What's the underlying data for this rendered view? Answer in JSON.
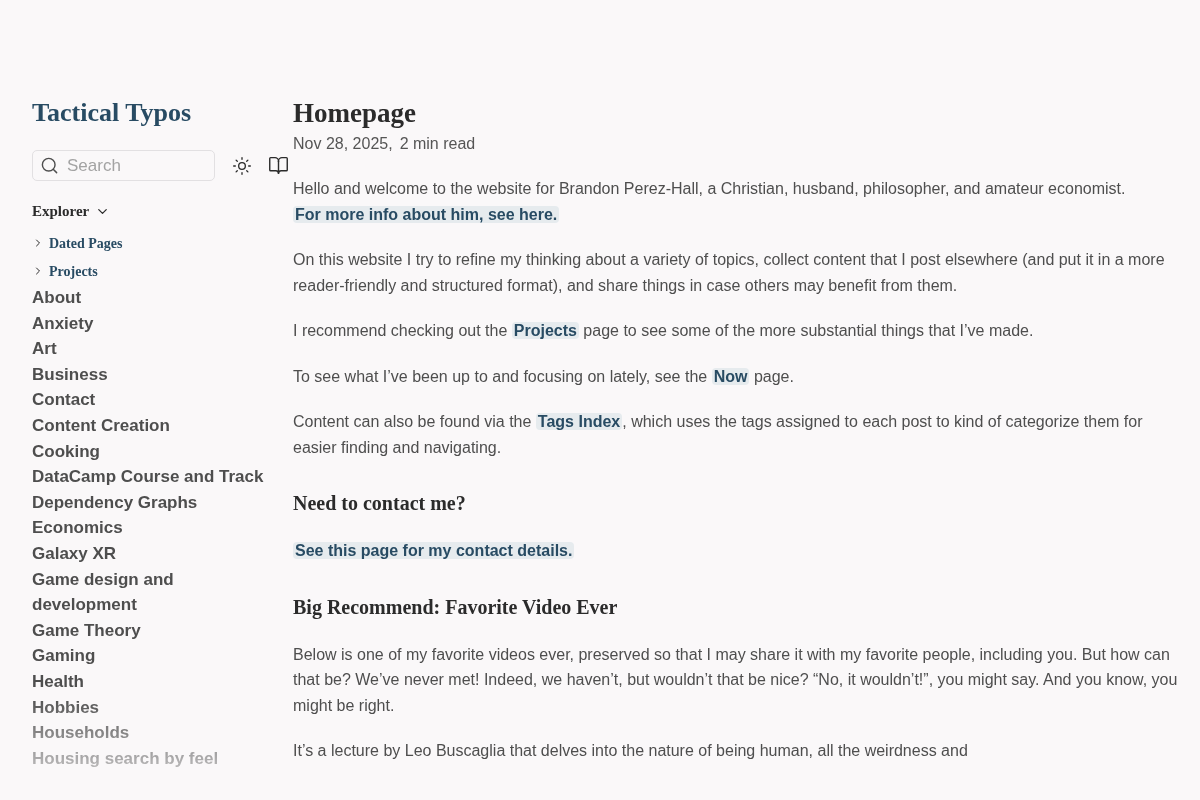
{
  "sidebar": {
    "site_title": "Tactical Typos",
    "search": {
      "placeholder": "Search"
    },
    "explorer": {
      "title": "Explorer",
      "expanded": true,
      "items": [
        {
          "kind": "folder",
          "label": "Dated Pages",
          "expanded": false
        },
        {
          "kind": "folder",
          "label": "Projects",
          "expanded": false
        },
        {
          "kind": "file",
          "label": "About"
        },
        {
          "kind": "file",
          "label": "Anxiety"
        },
        {
          "kind": "file",
          "label": "Art"
        },
        {
          "kind": "file",
          "label": "Business"
        },
        {
          "kind": "file",
          "label": "Contact"
        },
        {
          "kind": "file",
          "label": "Content Creation"
        },
        {
          "kind": "file",
          "label": "Cooking"
        },
        {
          "kind": "file",
          "label": "DataCamp Course and Track"
        },
        {
          "kind": "file",
          "label": "Dependency Graphs"
        },
        {
          "kind": "file",
          "label": "Economics"
        },
        {
          "kind": "file",
          "label": "Galaxy XR"
        },
        {
          "kind": "file",
          "label": "Game design and development"
        },
        {
          "kind": "file",
          "label": "Game Theory"
        },
        {
          "kind": "file",
          "label": "Gaming"
        },
        {
          "kind": "file",
          "label": "Health"
        },
        {
          "kind": "file",
          "label": "Hobbies"
        },
        {
          "kind": "file",
          "label": "Households"
        },
        {
          "kind": "file",
          "label": "Housing search by feel"
        }
      ]
    }
  },
  "page": {
    "title": "Homepage",
    "date": "Nov 28, 2025,",
    "reading_time": "2 min read",
    "blocks": [
      {
        "kind": "paragraph",
        "parts": [
          {
            "kind": "text",
            "text": "Hello and welcome to the website for Brandon Perez-Hall, a Christian, husband, philosopher, and amateur economist. "
          },
          {
            "kind": "link",
            "text": "For more info about him, see here."
          }
        ]
      },
      {
        "kind": "paragraph",
        "parts": [
          {
            "kind": "text",
            "text": "On this website I try to refine my thinking about a variety of topics, collect content that I post elsewhere (and put it in a more reader-friendly and structured format), and share things in case others may benefit from them."
          }
        ]
      },
      {
        "kind": "paragraph",
        "parts": [
          {
            "kind": "text",
            "text": "I recommend checking out the "
          },
          {
            "kind": "link",
            "text": "Projects"
          },
          {
            "kind": "text",
            "text": " page to see some of the more substantial things that I’ve made."
          }
        ]
      },
      {
        "kind": "paragraph",
        "parts": [
          {
            "kind": "text",
            "text": "To see what I’ve been up to and focusing on lately, see the "
          },
          {
            "kind": "link",
            "text": "Now"
          },
          {
            "kind": "text",
            "text": " page."
          }
        ]
      },
      {
        "kind": "paragraph",
        "parts": [
          {
            "kind": "text",
            "text": "Content can also be found via the "
          },
          {
            "kind": "link",
            "text": "Tags Index"
          },
          {
            "kind": "text",
            "text": ", which uses the tags assigned to each post to kind of categorize them for easier finding and navigating."
          }
        ]
      },
      {
        "kind": "heading",
        "text": "Need to contact me?"
      },
      {
        "kind": "paragraph",
        "parts": [
          {
            "kind": "link",
            "text": "See this page for my contact details."
          }
        ]
      },
      {
        "kind": "heading",
        "text": "Big Recommend: Favorite Video Ever"
      },
      {
        "kind": "paragraph",
        "parts": [
          {
            "kind": "text",
            "text": "Below is one of my favorite videos ever, preserved so that I may share it with my favorite people, including you. But how can that be? We’ve never met! Indeed, we haven’t, but wouldn’t that be nice? “No, it wouldn’t!”, you might say. And you know, you might be right."
          }
        ]
      },
      {
        "kind": "paragraph",
        "parts": [
          {
            "kind": "text",
            "text": "It’s a lecture by Leo Buscaglia that delves into the nature of being human, all the weirdness and"
          }
        ]
      }
    ]
  }
}
